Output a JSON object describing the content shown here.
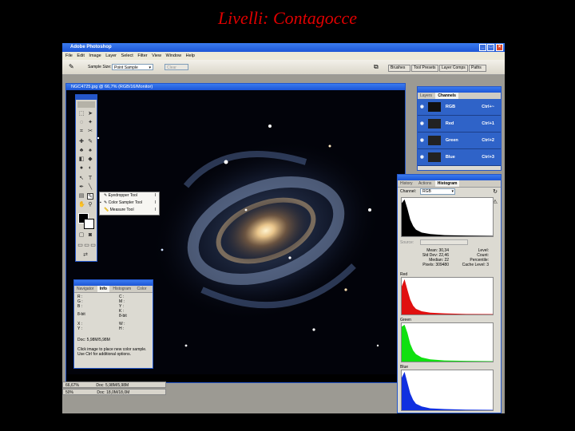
{
  "slide": {
    "title": "Livelli: Contagocce"
  },
  "window": {
    "title": "Adobe Photoshop"
  },
  "menu": [
    "File",
    "Edit",
    "Image",
    "Layer",
    "Select",
    "Filter",
    "View",
    "Window",
    "Help"
  ],
  "options_bar": {
    "sample_size_label": "Sample Size:",
    "sample_size_value": "Point Sample",
    "clear_label": "Clear",
    "dock_tabs": [
      "Brushes",
      "Tool Presets",
      "Layer Comps",
      "Paths"
    ]
  },
  "document": {
    "title": "NGC4725.jpg @ 66,7% (RGB/16/Monitor)",
    "status": [
      {
        "zoom": "66,67%",
        "doc": "Doc: 5,98M/5,98M"
      },
      {
        "zoom": "50%",
        "doc": "Doc: 18,0M/18,0M"
      }
    ]
  },
  "flyout": {
    "items": [
      {
        "label": "Eyedropper Tool",
        "key": "I"
      },
      {
        "label": "Color Sampler Tool",
        "key": "I"
      },
      {
        "label": "Measure Tool",
        "key": "I"
      }
    ]
  },
  "channels_panel": {
    "tabs": [
      "Layers",
      "Channels"
    ],
    "rows": [
      {
        "name": "RGB",
        "shortcut": "Ctrl+~"
      },
      {
        "name": "Red",
        "shortcut": "Ctrl+1"
      },
      {
        "name": "Green",
        "shortcut": "Ctrl+2"
      },
      {
        "name": "Blue",
        "shortcut": "Ctrl+3"
      }
    ]
  },
  "info_panel": {
    "tabs": [
      "Navigator",
      "Info",
      "Histogram",
      "Color"
    ],
    "left_block": [
      "R :",
      "G :",
      "B :"
    ],
    "right_block": [
      "C :",
      "M :",
      "Y :",
      "K :"
    ],
    "bit_left": "8-bit",
    "bit_right": "8-bit",
    "xy": [
      "X :",
      "Y :"
    ],
    "wh": [
      "W :",
      "H :"
    ],
    "doc": "Doc: 5,98M/5,98M",
    "help": [
      "Click image to place new color sample.",
      "Use Ctrl for additional options."
    ]
  },
  "histogram_panel": {
    "tabs": [
      "History",
      "Actions",
      "Histogram"
    ],
    "channel_label": "Channel:",
    "channel_value": "RGB",
    "source_label": "Source:",
    "stats_left": [
      {
        "k": "Mean:",
        "v": "30,34"
      },
      {
        "k": "Std Dev:",
        "v": "22,46"
      },
      {
        "k": "Median:",
        "v": "22"
      },
      {
        "k": "Pixels:",
        "v": "309480"
      }
    ],
    "stats_right": [
      {
        "k": "Level:",
        "v": ""
      },
      {
        "k": "Count:",
        "v": ""
      },
      {
        "k": "Percentile:",
        "v": ""
      },
      {
        "k": "Cache Level:",
        "v": "3"
      }
    ],
    "channels": [
      "Red",
      "Green",
      "Blue"
    ],
    "colors": {
      "rgb": "#000000",
      "red": "#e01010",
      "green": "#10e010",
      "blue": "#1030e0"
    }
  },
  "chart_data": {
    "type": "area",
    "x": [
      0,
      8,
      16,
      24,
      32,
      40,
      56,
      80,
      120,
      180,
      255
    ],
    "series": [
      {
        "name": "",
        "values": [
          0.9,
          1.0,
          0.75,
          0.45,
          0.28,
          0.18,
          0.1,
          0.06,
          0.03,
          0.02,
          0.01
        ]
      },
      {
        "name": "Red",
        "values": [
          0.8,
          1.0,
          0.7,
          0.42,
          0.25,
          0.16,
          0.09,
          0.05,
          0.03,
          0.015,
          0.01
        ]
      },
      {
        "name": "Green",
        "values": [
          0.95,
          1.0,
          0.78,
          0.48,
          0.3,
          0.2,
          0.11,
          0.06,
          0.03,
          0.02,
          0.01
        ]
      },
      {
        "name": "Blue",
        "values": [
          0.85,
          1.0,
          0.72,
          0.44,
          0.27,
          0.17,
          0.1,
          0.05,
          0.03,
          0.015,
          0.01
        ]
      }
    ]
  }
}
